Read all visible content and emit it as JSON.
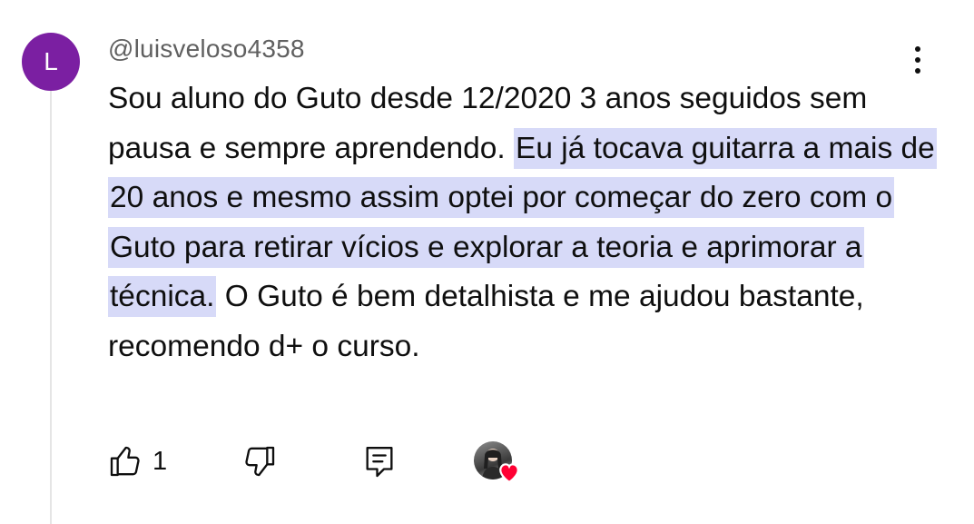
{
  "author": {
    "avatar_letter": "L",
    "avatar_color": "#7b1fa2",
    "username": "@luisveloso4358"
  },
  "comment": {
    "text_before": "Sou aluno do Guto desde 12/2020 3 anos seguidos sem pausa e sempre aprendendo. ",
    "text_highlighted": "Eu já tocava guitarra a mais de 20 anos e mesmo assim optei por começar do zero com o Guto para retirar vícios e explorar a teoria e aprimorar a técnica.",
    "text_after": " O Guto é bem detalhista e me ajudou bastante, recomendo d+ o curso.",
    "highlight_color": "#d7daf8"
  },
  "actions": {
    "like_icon": "thumbs-up-icon",
    "like_count": "1",
    "dislike_icon": "thumbs-down-icon",
    "reply_icon": "reply-icon",
    "creator_heart_icon": "heart-icon",
    "heart_color": "#ff0033"
  },
  "menu_icon": "more-vertical-icon"
}
